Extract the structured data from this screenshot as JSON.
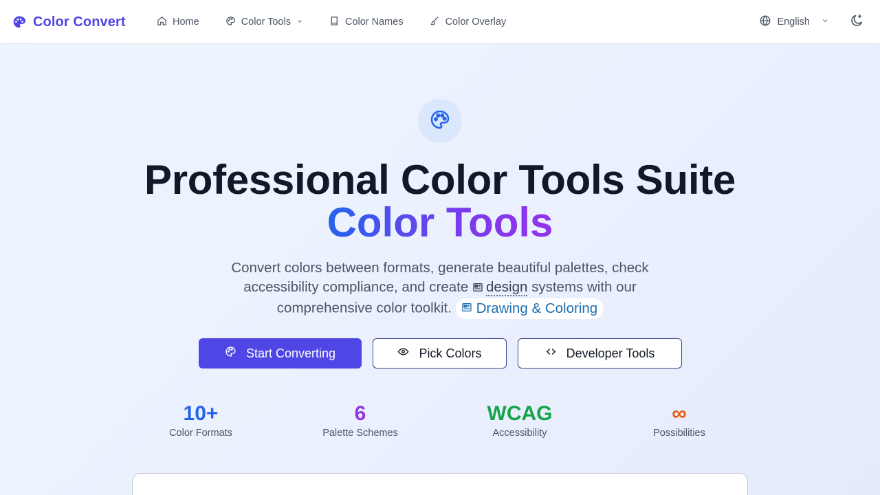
{
  "nav": {
    "brand": "Color Convert",
    "links": [
      {
        "label": "Home",
        "icon": "home-icon"
      },
      {
        "label": "Color Tools",
        "icon": "palette-icon",
        "has_dropdown": true
      },
      {
        "label": "Color Names",
        "icon": "book-icon"
      },
      {
        "label": "Color Overlay",
        "icon": "brush-icon"
      }
    ],
    "language": "English",
    "theme_icon": "moon-sparkle-icon"
  },
  "hero": {
    "icon": "palette-icon",
    "title": "Professional Color Tools Suite",
    "title_accent": "Color Tools",
    "description_part1": "Convert colors between formats, generate beautiful palettes, check accessibility compliance, and create",
    "description_link": "design",
    "description_part2": "systems with our comprehensive color toolkit.",
    "chip_label": "Drawing & Coloring"
  },
  "buttons": {
    "start": "Start Converting",
    "pick": "Pick Colors",
    "developer": "Developer Tools"
  },
  "stats": [
    {
      "value": "10+",
      "label": "Color Formats",
      "color": "#2563eb"
    },
    {
      "value": "6",
      "label": "Palette Schemes",
      "color": "#9333ea"
    },
    {
      "value": "WCAG",
      "label": "Accessibility",
      "color": "#16a34a"
    },
    {
      "value": "∞",
      "label": "Possibilities",
      "color": "#ea580c"
    }
  ],
  "colors": {
    "brand": "#4f46e5",
    "primary_button": "#4f46e5",
    "accent_gradient_start": "#2563eb",
    "accent_gradient_end": "#9333ea"
  }
}
